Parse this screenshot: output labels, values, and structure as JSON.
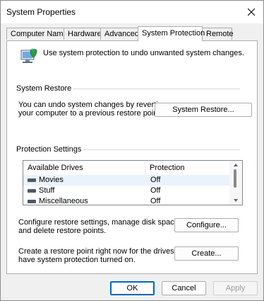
{
  "window": {
    "title": "System Properties"
  },
  "tabs": [
    {
      "label": "Computer Name",
      "active": false
    },
    {
      "label": "Hardware",
      "active": false
    },
    {
      "label": "Advanced",
      "active": false
    },
    {
      "label": "System Protection",
      "active": true
    },
    {
      "label": "Remote",
      "active": false
    }
  ],
  "intro": {
    "text": "Use system protection to undo unwanted system changes.",
    "icon": "computer-shield-icon"
  },
  "system_restore": {
    "title": "System Restore",
    "text_line1": "You can undo system changes by reverting",
    "text_line2": "your computer to a previous restore point.",
    "button_label": "System Restore..."
  },
  "protection_settings": {
    "title": "Protection Settings",
    "columns": [
      "Available Drives",
      "Protection"
    ],
    "drives": [
      {
        "name": "Movies",
        "protection": "Off",
        "icon": "drive-icon"
      },
      {
        "name": "Stuff",
        "protection": "Off",
        "icon": "drive-icon"
      },
      {
        "name": "Miscellaneous",
        "protection": "Off",
        "icon": "drive-icon"
      }
    ],
    "configure_text_line1": "Configure restore settings, manage disk space,",
    "configure_text_line2": "and delete restore points.",
    "configure_label": "Configure...",
    "create_text_line1": "Create a restore point right now for the drives that",
    "create_text_line2": "have system protection turned on.",
    "create_label": "Create..."
  },
  "footer": {
    "ok_label": "OK",
    "cancel_label": "Cancel",
    "apply_label": "Apply"
  },
  "colors": {
    "dialog_bg": "#f0f0f0",
    "accent": "#0067c0",
    "selected_row": "#eaf2fb"
  }
}
